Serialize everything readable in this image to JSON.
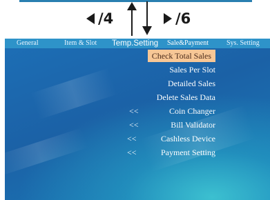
{
  "nav_hint": {
    "left_label": "/4",
    "right_label": "/6"
  },
  "tabs": [
    {
      "label": "General"
    },
    {
      "label": "Item & Slot"
    },
    {
      "label": "Temp.Setting"
    },
    {
      "label": "Sale&Payment"
    },
    {
      "label": "Sys. Setting"
    }
  ],
  "menu": [
    {
      "label": "Check Total Sales",
      "prefix": ""
    },
    {
      "label": "Sales Per Slot",
      "prefix": ""
    },
    {
      "label": "Detailed Sales",
      "prefix": ""
    },
    {
      "label": "Delete Sales Data",
      "prefix": ""
    },
    {
      "label": "Coin Changer",
      "prefix": "<<"
    },
    {
      "label": "Bill Validator",
      "prefix": "<<"
    },
    {
      "label": "Cashless Device",
      "prefix": "<<"
    },
    {
      "label": "Payment Setting",
      "prefix": "<<"
    }
  ],
  "colors": {
    "tab_bar": "#2e93c9",
    "selected_highlight": "#f7c796",
    "screen_bg": "#1d6fb6"
  }
}
